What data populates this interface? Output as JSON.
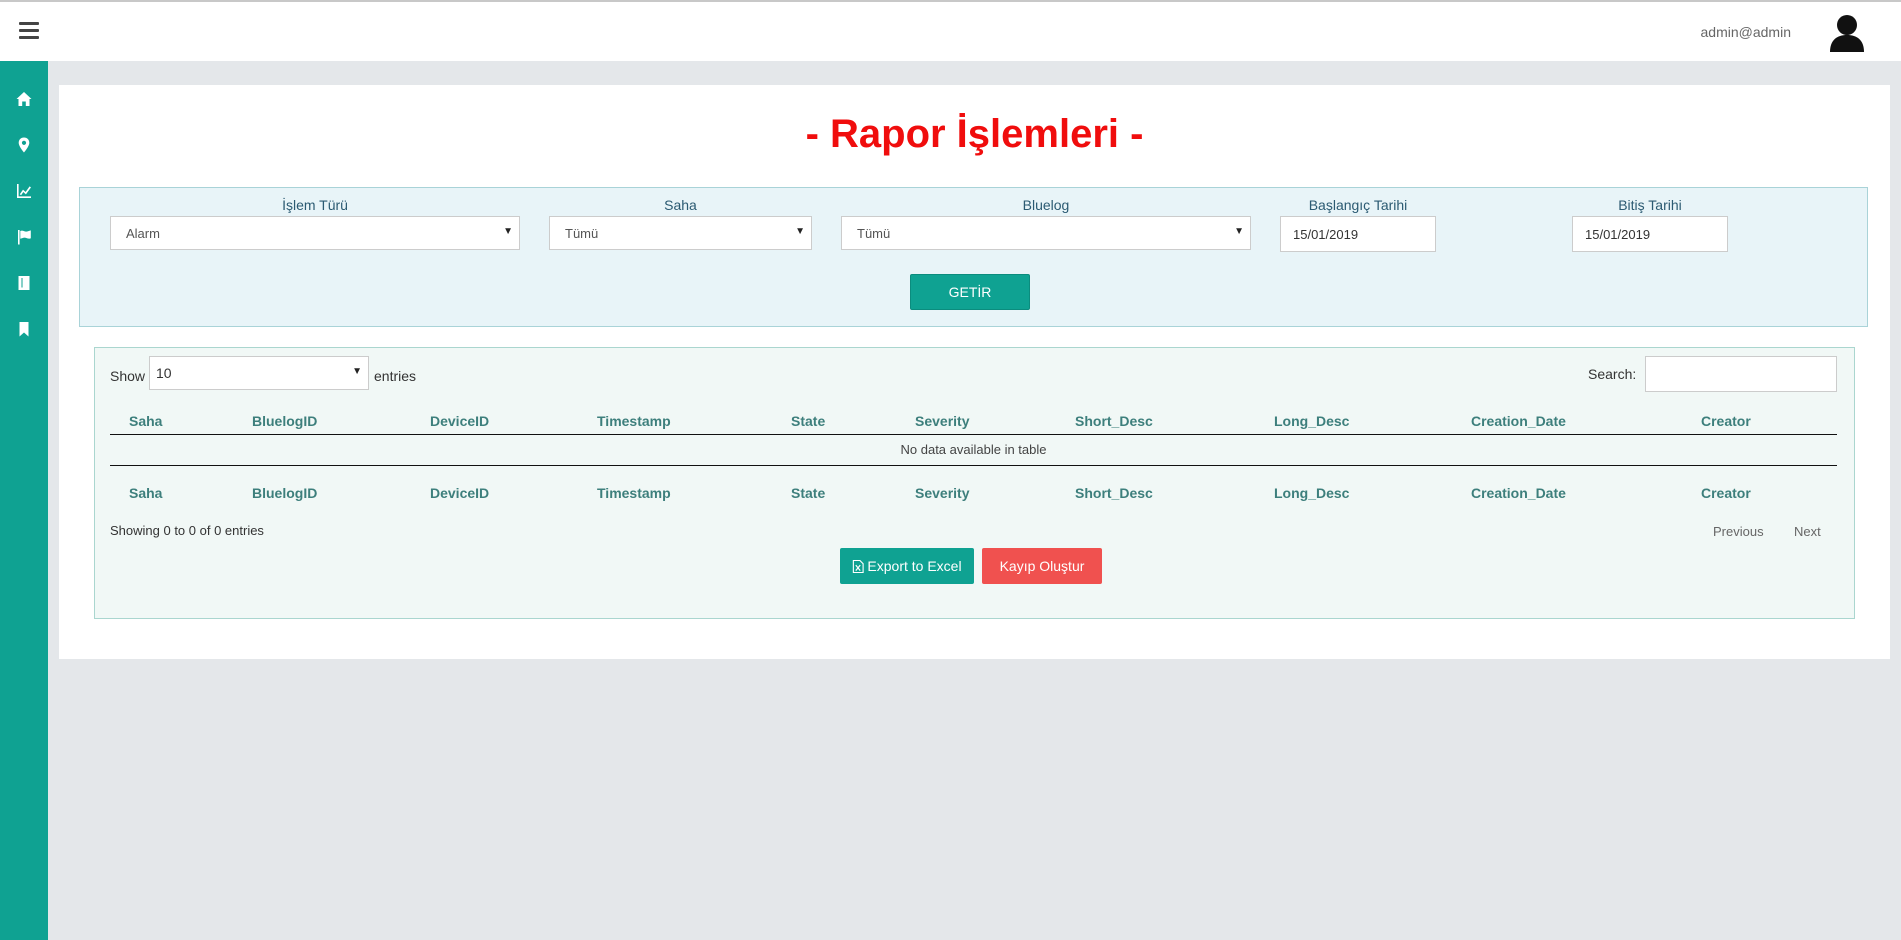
{
  "header": {
    "user_email": "admin@admin"
  },
  "sidebar": {
    "items": [
      {
        "icon": "home-icon"
      },
      {
        "icon": "map-marker-icon"
      },
      {
        "icon": "line-chart-icon"
      },
      {
        "icon": "flag-icon"
      },
      {
        "icon": "book-icon"
      },
      {
        "icon": "bookmark-icon"
      }
    ]
  },
  "page": {
    "title": "- Rapor İşlemleri -"
  },
  "filters": {
    "islem_turu": {
      "label": "İşlem Türü",
      "value": "Alarm"
    },
    "saha": {
      "label": "Saha",
      "value": "Tümü"
    },
    "bluelog": {
      "label": "Bluelog",
      "value": "Tümü"
    },
    "baslangic": {
      "label": "Başlangıç Tarihi",
      "value": "15/01/2019"
    },
    "bitis": {
      "label": "Bitiş Tarihi",
      "value": "15/01/2019"
    },
    "submit_label": "GETİR"
  },
  "table": {
    "show_label": "Show",
    "length_value": "10",
    "entries_label": "entries",
    "search_label": "Search:",
    "columns": [
      "Saha",
      "BluelogID",
      "DeviceID",
      "Timestamp",
      "State",
      "Severity",
      "Short_Desc",
      "Long_Desc",
      "Creation_Date",
      "Creator"
    ],
    "empty_message": "No data available in table",
    "info": "Showing 0 to 0 of 0 entries",
    "prev_label": "Previous",
    "next_label": "Next"
  },
  "actions": {
    "export_label": "Export to Excel",
    "kayip_label": "Kayıp Oluştur"
  },
  "colors": {
    "sidebar": "#0fa292",
    "title": "#f00d0d",
    "danger": "#f0514f"
  }
}
